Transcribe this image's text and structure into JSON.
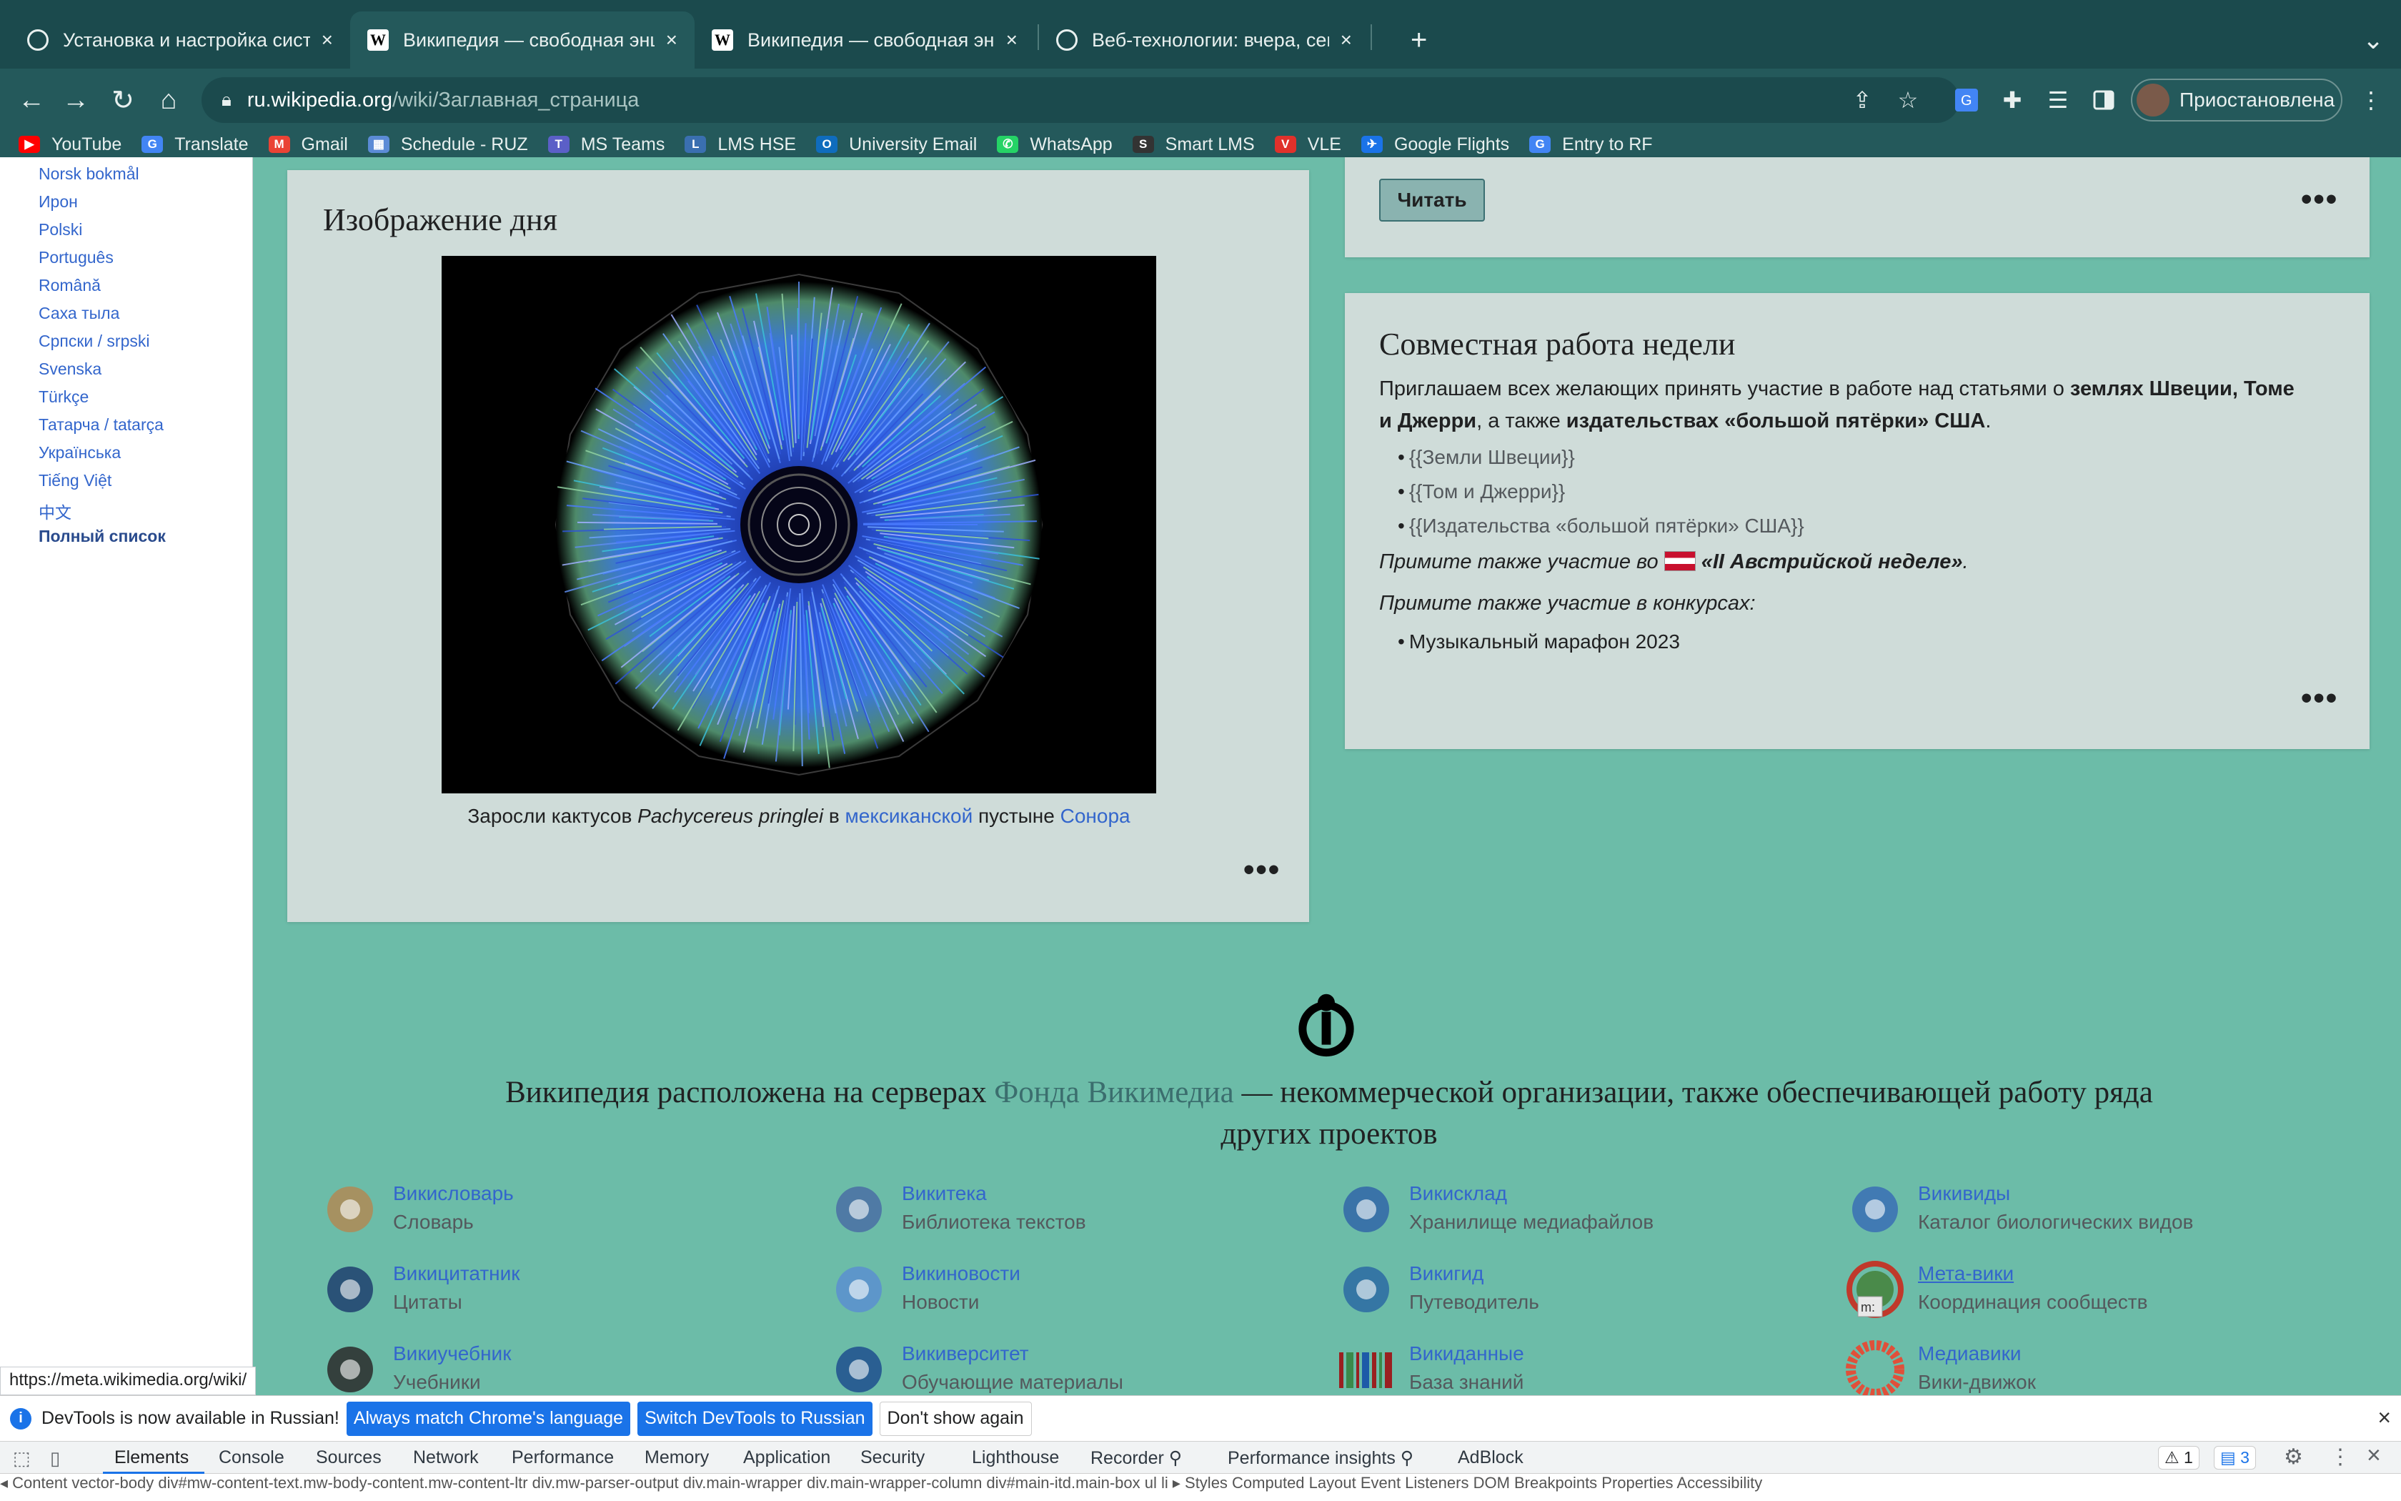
{
  "browser": {
    "tabs": [
      {
        "label": "Установка и настройка систе",
        "icon": "chatgpt-icon"
      },
      {
        "label": "Википедия — свободная энци",
        "icon": "wikipedia-icon"
      },
      {
        "label": "Википедия — свободная энци",
        "icon": "wikipedia-icon"
      },
      {
        "label": "Веб-технологии: вчера, сегод",
        "icon": "chatgpt-icon"
      }
    ],
    "tab_close": "×",
    "new_tab": "+",
    "tab_menu": "⌄",
    "back": "←",
    "forward": "→",
    "reload": "↻",
    "home": "⌂",
    "url_host": "ru.wikipedia.org",
    "url_path": "/wiki/Заглавная_страница",
    "profile_label": "Приостановлена",
    "menu": "⋮",
    "bookmarks": [
      {
        "label": "YouTube",
        "color": "#ff0000",
        "glyph": "▶"
      },
      {
        "label": "Translate",
        "color": "#4285f4",
        "glyph": "G"
      },
      {
        "label": "Gmail",
        "color": "#ea4335",
        "glyph": "M"
      },
      {
        "label": "Schedule - RUZ",
        "color": "#5b8bd6",
        "glyph": "▦"
      },
      {
        "label": "MS Teams",
        "color": "#5b5fc7",
        "glyph": "T"
      },
      {
        "label": "LMS HSE",
        "color": "#3a6fb0",
        "glyph": "L"
      },
      {
        "label": "University Email",
        "color": "#0f6cbd",
        "glyph": "O"
      },
      {
        "label": "WhatsApp",
        "color": "#25d366",
        "glyph": "✆"
      },
      {
        "label": "Smart LMS",
        "color": "#333333",
        "glyph": "S"
      },
      {
        "label": "VLE",
        "color": "#e0312b",
        "glyph": "V"
      },
      {
        "label": "Google Flights",
        "color": "#1a73e8",
        "glyph": "✈"
      },
      {
        "label": "Entry to RF",
        "color": "#4285f4",
        "glyph": "G"
      }
    ]
  },
  "sidebar": {
    "languages": [
      "Norsk bokmål",
      "Ирон",
      "Polski",
      "Português",
      "Română",
      "Саха тыла",
      "Српски / srpski",
      "Svenska",
      "Türkçe",
      "Татарча / tatarça",
      "Українська",
      "Tiếng Việt",
      "中文"
    ],
    "full_list": "Полный список"
  },
  "pod": {
    "title": "Изображение дня",
    "caption_pre": "Заросли кактусов ",
    "caption_italic": "Pachycereus pringlei",
    "caption_mid": " в ",
    "caption_link1": "мексиканской",
    "caption_mid2": " пустыне ",
    "caption_link2": "Сонора",
    "more": "•••"
  },
  "read_card": {
    "button": "Читать",
    "more": "•••"
  },
  "collab": {
    "title": "Совместная работа недели",
    "intro_pre": "Приглашаем всех желающих принять участие в работе над статьями о ",
    "intro_bold1": "землях Швеции, Томе и Джерри",
    "intro_mid": ", а также ",
    "intro_bold2": "издательствах «большой пятёрки» США",
    "intro_end": ".",
    "items": [
      "{{Земли Швеции}}",
      "{{Том и Джерри}}",
      "{{Издательства «большой пятёрки» США}}"
    ],
    "austria_pre": "Примите также участие во ",
    "austria_bold": "«II Австрийской неделе»",
    "austria_end": ".",
    "contests_label": "Примите также участие в конкурсах:",
    "contests": [
      "Музыкальный марафон 2023"
    ],
    "more": "•••"
  },
  "footer": {
    "text_pre": "Википедия расположена на серверах ",
    "text_link": "Фонда Викимедиа",
    "text_post": " — некоммерческой организации, также обеспечивающей работу ряда других проектов",
    "projects": [
      {
        "name": "Викисловарь",
        "desc": "Словарь",
        "icon": "wiktionary-icon"
      },
      {
        "name": "Викитека",
        "desc": "Библиотека текстов",
        "icon": "wikisource-icon"
      },
      {
        "name": "Викисклад",
        "desc": "Хранилище медиафайлов",
        "icon": "commons-icon"
      },
      {
        "name": "Викивиды",
        "desc": "Каталог биологических видов",
        "icon": "wikispecies-icon"
      },
      {
        "name": "Викицитатник",
        "desc": "Цитаты",
        "icon": "wikiquote-icon"
      },
      {
        "name": "Викиновости",
        "desc": "Новости",
        "icon": "wikinews-icon"
      },
      {
        "name": "Викигид",
        "desc": "Путеводитель",
        "icon": "wikivoyage-icon"
      },
      {
        "name": "Мета-вики",
        "desc": "Координация сообществ",
        "icon": "meta-wiki-icon"
      },
      {
        "name": "Викиучебник",
        "desc": "Учебники",
        "icon": "wikibooks-icon"
      },
      {
        "name": "Викиверситет",
        "desc": "Обучающие материалы",
        "icon": "wikiversity-icon"
      },
      {
        "name": "Викиданные",
        "desc": "База знаний",
        "icon": "wikidata-icon"
      },
      {
        "name": "Медиавики",
        "desc": "Вики-движок",
        "icon": "mediawiki-icon"
      }
    ],
    "meta_icon_label": "m:"
  },
  "status_url": "https://meta.wikimedia.org/wiki/",
  "devtools": {
    "info_text": "DevTools is now available in Russian!",
    "btn_match": "Always match Chrome's language",
    "btn_switch": "Switch DevTools to Russian",
    "btn_dont": "Don't show again",
    "close": "×",
    "tabs": [
      "Elements",
      "Console",
      "Sources",
      "Network",
      "Performance",
      "Memory",
      "Application",
      "Security",
      "Lighthouse",
      "Recorder ⚲",
      "Performance insights ⚲",
      "AdBlock"
    ],
    "warnings": "⚠ 1",
    "messages": "▤ 3",
    "breadcrumb": "◂  Content  vector-body   div#mw-content-text.mw-body-content.mw-content-ltr   div.mw-parser-output   div.main-wrapper   div.main-wrapper-column   div#main-itd.main-box   ul   li   ▸   Styles   Computed   Layout   Event Listeners   DOM Breakpoints   Properties   Accessibility"
  }
}
